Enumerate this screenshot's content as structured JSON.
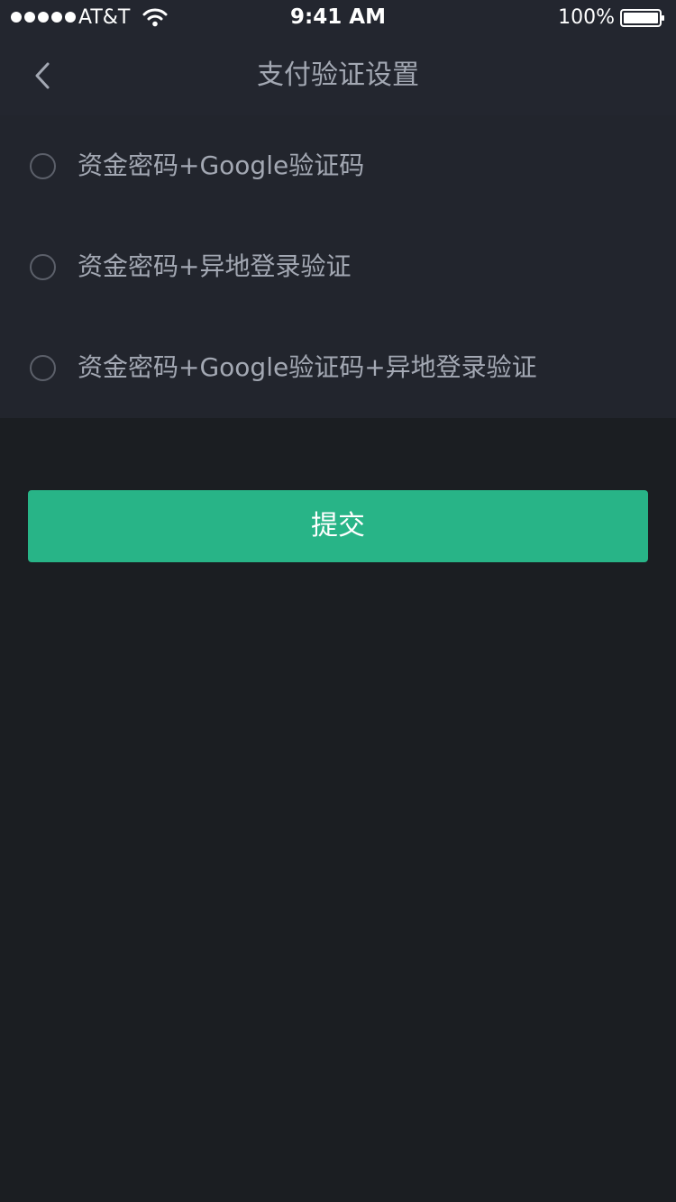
{
  "status_bar": {
    "carrier": "AT&T",
    "time": "9:41 AM",
    "battery_percent": "100%",
    "signal_icon": "signal-dots-icon",
    "wifi_icon": "wifi-icon",
    "battery_icon": "battery-icon"
  },
  "nav": {
    "back_icon": "chevron-left-icon",
    "title": "支付验证设置"
  },
  "options": [
    {
      "label": "资金密码+Google验证码",
      "selected": false
    },
    {
      "label": "资金密码+异地登录验证",
      "selected": false
    },
    {
      "label": "资金密码+Google验证码+异地登录验证",
      "selected": false
    }
  ],
  "submit": {
    "label": "提交"
  },
  "colors": {
    "background": "#1b1e22",
    "header": "#23262f",
    "options_panel": "#22252d",
    "text": "#a3a8b3",
    "accent": "#28b487",
    "radio_border": "#5c606a"
  }
}
